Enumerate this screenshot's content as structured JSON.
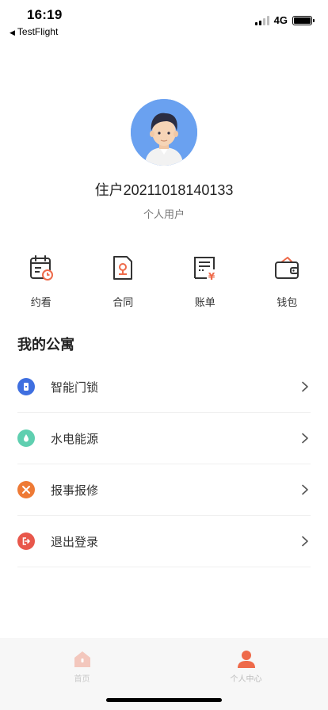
{
  "status_bar": {
    "time": "16:19",
    "back_label": "TestFlight",
    "network": "4G"
  },
  "profile": {
    "name": "住户20211018140133",
    "role": "个人用户"
  },
  "shortcuts": [
    {
      "label": "约看",
      "icon": "calendar-clock-icon"
    },
    {
      "label": "合同",
      "icon": "contract-icon"
    },
    {
      "label": "账单",
      "icon": "bill-icon"
    },
    {
      "label": "钱包",
      "icon": "wallet-icon"
    }
  ],
  "section_title": "我的公寓",
  "menu": [
    {
      "label": "智能门锁",
      "icon": "smart-lock-icon",
      "color": "#3f6fe0"
    },
    {
      "label": "水电能源",
      "icon": "water-drop-icon",
      "color": "#5fcfb0"
    },
    {
      "label": "报事报修",
      "icon": "repair-tools-icon",
      "color": "#ee7a35"
    },
    {
      "label": "退出登录",
      "icon": "logout-icon",
      "color": "#e8574b"
    }
  ],
  "tab_bar": {
    "home_label": "首页",
    "profile_label": "个人中心"
  },
  "colors": {
    "accent": "#ee6a4a",
    "icon_dark": "#333333",
    "avatar_bg": "#6aa1f0"
  }
}
